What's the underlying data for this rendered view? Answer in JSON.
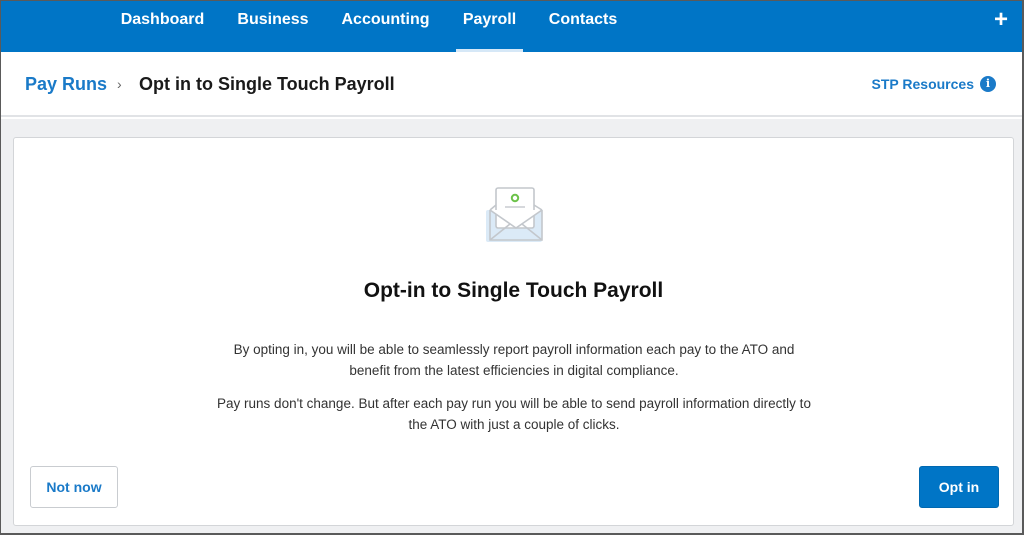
{
  "topnav": {
    "tabs": [
      {
        "label": "Dashboard",
        "active": false
      },
      {
        "label": "Business",
        "active": false
      },
      {
        "label": "Accounting",
        "active": false
      },
      {
        "label": "Payroll",
        "active": true
      },
      {
        "label": "Contacts",
        "active": false
      }
    ],
    "add_icon": "plus-icon",
    "add_glyph": "+"
  },
  "header": {
    "breadcrumb_parent": "Pay Runs",
    "breadcrumb_separator": "›",
    "page_title": "Opt in to Single Touch Payroll",
    "resources_link": "STP Resources",
    "info_glyph": "i"
  },
  "card": {
    "illustration": "envelope-letter-icon",
    "title": "Opt-in to Single Touch Payroll",
    "paragraph1": "By opting in, you will be able to seamlessly report payroll information each pay to the ATO and benefit from the latest efficiencies in digital compliance.",
    "paragraph2": "Pay runs don't change. But after each pay run you will be able to send payroll information directly to the ATO with just a couple of clicks.",
    "secondary_button": "Not now",
    "primary_button": "Opt in"
  },
  "colors": {
    "brand_blue": "#0075c6",
    "link_blue": "#1a7ac8",
    "accent_green": "#6cc24a",
    "background_gray": "#eff0f2"
  }
}
